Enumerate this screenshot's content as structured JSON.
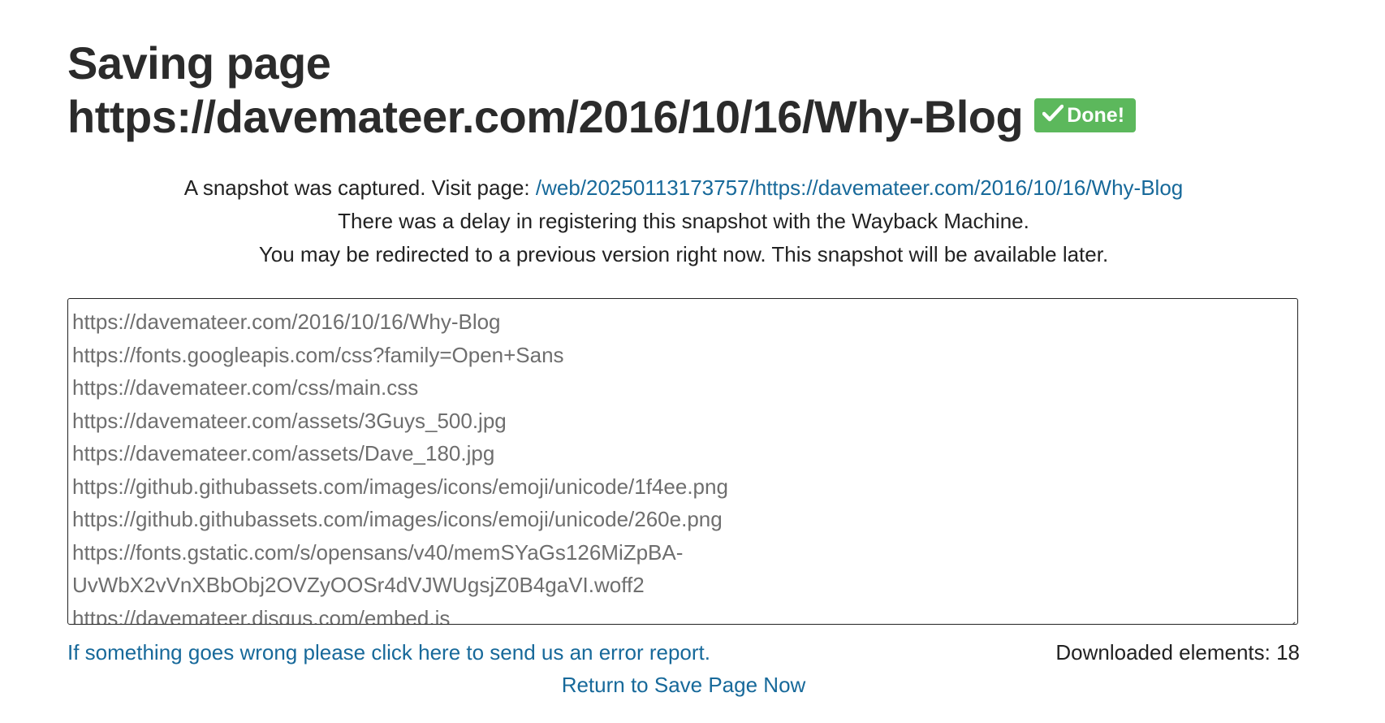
{
  "heading": {
    "title_line": "Saving page",
    "url": "https://davemateer.com/2016/10/16/Why-Blog",
    "status_badge": "Done!",
    "status_icon": "checkmark-icon",
    "badge_color": "#5cb85c"
  },
  "info": {
    "captured_prefix": "A snapshot was captured. Visit page:",
    "snapshot_link": "/web/20250113173757/https://davemateer.com/2016/10/16/Why-Blog",
    "delay_notice": "There was a delay in registering this snapshot with the Wayback Machine.",
    "redirect_notice": "You may be redirected to a previous version right now. This snapshot will be available later."
  },
  "url_log": {
    "lines": [
      "https://davemateer.com/2016/10/16/Why-Blog",
      "https://fonts.googleapis.com/css?family=Open+Sans",
      "https://davemateer.com/css/main.css",
      "https://davemateer.com/assets/3Guys_500.jpg",
      "https://davemateer.com/assets/Dave_180.jpg",
      "https://github.githubassets.com/images/icons/emoji/unicode/1f4ee.png",
      "https://github.githubassets.com/images/icons/emoji/unicode/260e.png",
      "https://fonts.gstatic.com/s/opensans/v40/memSYaGs126MiZpBA-",
      "UvWbX2vVnXBbObj2OVZyOOSr4dVJWUgsjZ0B4gaVI.woff2",
      "https://davemateer.disqus.com/embed.js"
    ]
  },
  "footer": {
    "error_report_link": "If something goes wrong please click here to send us an error report.",
    "downloaded_elements": "Downloaded elements: 18",
    "return_link": "Return to Save Page Now"
  },
  "colors": {
    "link": "#17699a",
    "text": "#222222",
    "log_text": "#6e6e6e",
    "success": "#5cb85c"
  }
}
